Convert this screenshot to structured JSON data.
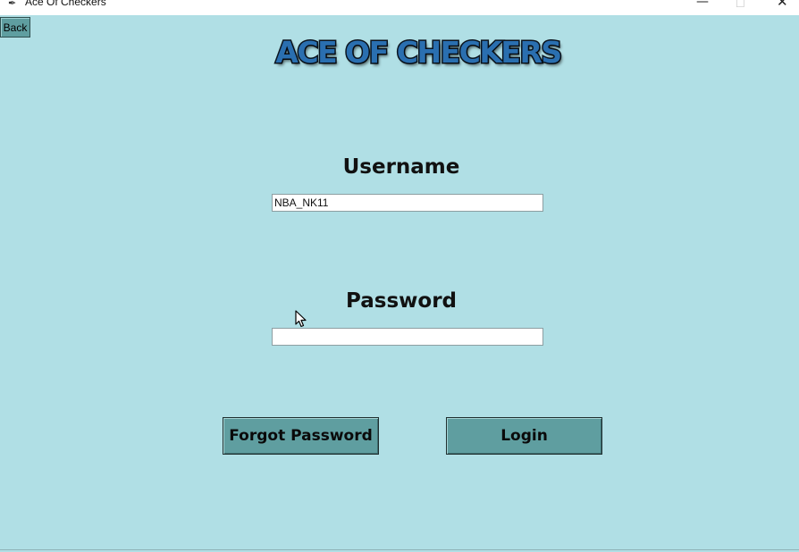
{
  "window": {
    "title": "Ace Of Checkers",
    "icon": "feather-icon",
    "controls": {
      "minimize": "—",
      "maximize": "☐",
      "close": "✕"
    }
  },
  "nav": {
    "back_label": "Back"
  },
  "header": {
    "logo_text": "ACE OF CHECKERS"
  },
  "form": {
    "username_label": "Username",
    "username_value": "NBA_NK11",
    "password_label": "Password",
    "password_value": ""
  },
  "actions": {
    "forgot_password_label": "Forgot Password",
    "login_label": "Login"
  },
  "colors": {
    "background": "#b0dfe5",
    "button": "#5f9ea0",
    "logo_fill": "#2a6fb0"
  }
}
